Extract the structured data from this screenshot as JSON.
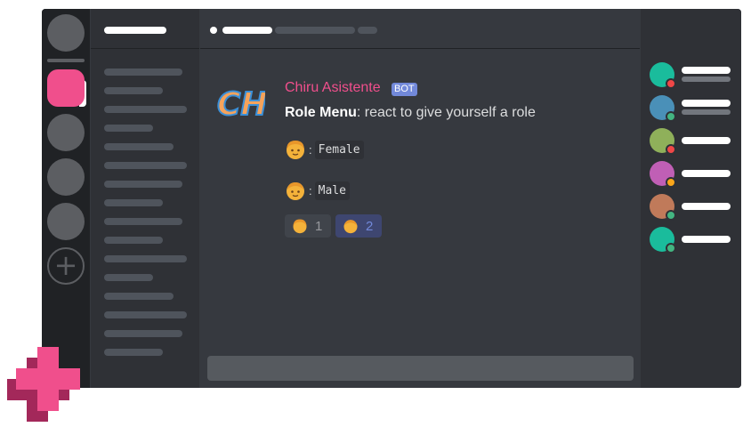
{
  "message": {
    "author": "Chiru Asistente",
    "bot_tag": "BOT",
    "avatar_text": "CH",
    "text_bold": "Role Menu",
    "text_rest": ": react to give yourself a role",
    "options": [
      {
        "emoji": "woman-emoji",
        "label": "Female"
      },
      {
        "emoji": "man-emoji",
        "label": "Male"
      }
    ],
    "reactions": [
      {
        "emoji": "woman-emoji",
        "count": "1",
        "reacted_by_me": false
      },
      {
        "emoji": "man-emoji",
        "count": "2",
        "reacted_by_me": true
      }
    ]
  },
  "colors": {
    "brand_pink": "#f04f8c",
    "blurple": "#7289da",
    "background": "#36393f",
    "sidebar": "#2f3136",
    "rail": "#202225"
  },
  "members": [
    {
      "avatar_color": "#1abc9c",
      "status": "dnd"
    },
    {
      "avatar_color": "#4a90b8",
      "status": "online"
    },
    {
      "avatar_color": "#8fb05a",
      "status": "dnd"
    },
    {
      "avatar_color": "#c05fb5",
      "status": "idle"
    },
    {
      "avatar_color": "#c07a5a",
      "status": "online"
    },
    {
      "avatar_color": "#1abc9c",
      "status": "online"
    }
  ]
}
